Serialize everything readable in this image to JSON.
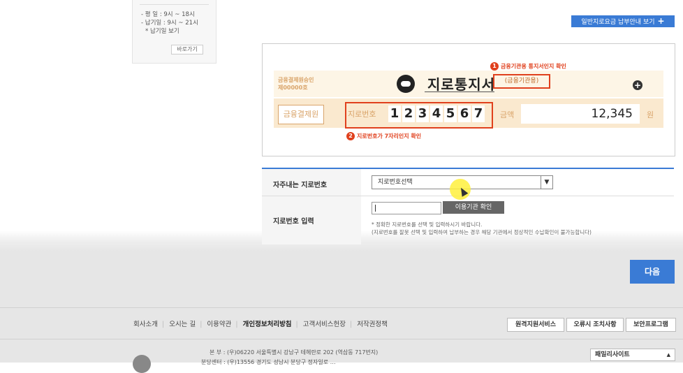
{
  "left_box": {
    "line1": "- 평    일 : 9시 ~ 18시",
    "line2": "- 납기일 : 9시 ~ 21시",
    "line3": "* 납기일 보기",
    "shortcut": "바로가기"
  },
  "guide_button": {
    "label": "일반지로요금 납부안내 보기",
    "icon": "+"
  },
  "sample": {
    "note1_num": "1",
    "note1": "금융기관용 통지서인지 확인",
    "approval": "금융결제원승인\n제00000호",
    "title": "지로통지서",
    "subtitle": "(금융기관용)",
    "plus_icon": "+",
    "fin_label": "금융결제원",
    "giro_label": "지로번호",
    "digits": [
      "1",
      "2",
      "3",
      "4",
      "5",
      "6",
      "7"
    ],
    "amount_label": "금액",
    "amount": "12,345",
    "won": "원",
    "note2_num": "2",
    "note2": "지로번호가 7자리인지 확인"
  },
  "form": {
    "frequent_label": "자주내는 지로번호",
    "select_value": "지로번호선택",
    "input_label": "지로번호 입력",
    "confirm_button": "이용기관 확인",
    "hint1": "* 정확한 지로번호를 선택 및 입력하시기 바랍니다.",
    "hint2": "(지로번호를 잘못 선택 및 입력하여 납부하는 경우 해당 기관에서 정상적인 수납확인이 불가능합니다)"
  },
  "next_button": "다음",
  "footer": {
    "links": [
      "회사소개",
      "오시는 길",
      "이용약관",
      "개인정보처리방침",
      "고객서비스헌장",
      "저작권정책"
    ],
    "buttons": [
      "원격지원서비스",
      "오류시 조치사항",
      "보안프로그램"
    ],
    "address1": "본      부 : (우)06220 서울특별시 강남구 테헤란로 202 (역삼동 717번지)",
    "address2": "분당센터 : (우)13556 경기도 성남시 분당구 정자일로 …",
    "family_site": "패밀리사이트",
    "family_arrow": "▲"
  },
  "colors": {
    "accent": "#3a7bd5",
    "alert": "#e0401d",
    "gold": "#d9a46a"
  }
}
